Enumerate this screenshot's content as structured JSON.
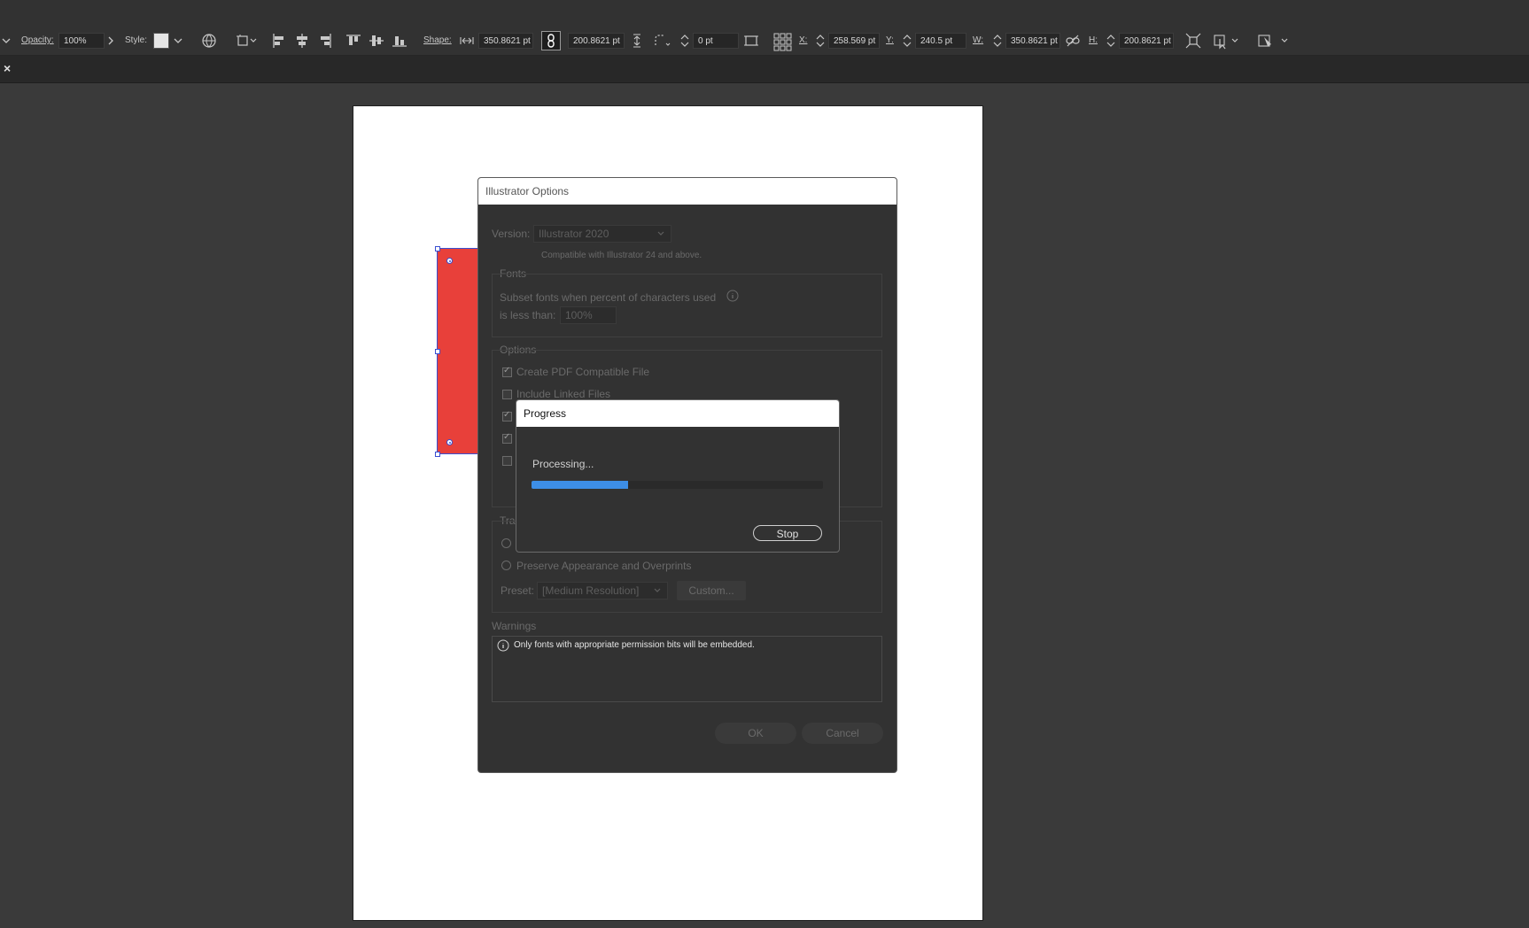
{
  "control_bar": {
    "opacity_label": "Opacity:",
    "opacity_value": "100%",
    "style_label": "Style:",
    "shape_label": "Shape:",
    "shape_width": "350.8621 pt",
    "shape_height": "200.8621 pt",
    "corner_radius": "0 pt",
    "x_label": "X:",
    "x_value": "258.569 pt",
    "y_label": "Y:",
    "y_value": "240.5 pt",
    "w_label": "W:",
    "w_value": "350.8621 pt",
    "h_label": "H:",
    "h_value": "200.8621 pt"
  },
  "tab_bar": {
    "close_glyph": "×"
  },
  "illustrator_options": {
    "title": "Illustrator Options",
    "version_label": "Version:",
    "version_value": "Illustrator 2020",
    "compat_note": "Compatible with Illustrator 24 and above.",
    "fonts_group": "Fonts",
    "subset_text_1": "Subset fonts when percent of characters used",
    "subset_text_2": "is less than:",
    "subset_value": "100%",
    "options_group": "Options",
    "create_pdf": "Create PDF Compatible File",
    "include_linked": "Include Linked Files",
    "transparency_group": "Tra",
    "preserve_appearance": "Preserve Appearance and Overprints",
    "preset_label": "Preset:",
    "preset_value": "[Medium Resolution]",
    "custom_button": "Custom...",
    "warnings_label": "Warnings",
    "warning_text": "Only fonts with appropriate permission bits will be embedded.",
    "ok_button": "OK",
    "cancel_button": "Cancel"
  },
  "progress_dialog": {
    "title": "Progress",
    "status": "Processing...",
    "progress_fraction": 0.33,
    "progress_color": "#3d8ee6",
    "stop_button": "Stop"
  },
  "colors": {
    "shape_fill": "#e8403a",
    "selection": "#3a4fd1"
  },
  "icons": [
    "chevron-down-icon",
    "chevron-right-icon",
    "globe-icon",
    "transform-icon",
    "align-left-icon",
    "align-hcenter-icon",
    "align-right-icon",
    "align-top-icon",
    "align-vcenter-icon",
    "align-bottom-icon",
    "constrain-link-icon",
    "height-icon",
    "corner-type-icon",
    "corner-stepper-icon",
    "artboard-icon",
    "reference-point-icon",
    "x-stepper-icon",
    "y-stepper-icon",
    "w-stepper-icon",
    "unlink-icon",
    "h-stepper-icon",
    "isolate-icon",
    "select-similar-icon",
    "recolor-icon",
    "info-icon",
    "close-icon"
  ]
}
